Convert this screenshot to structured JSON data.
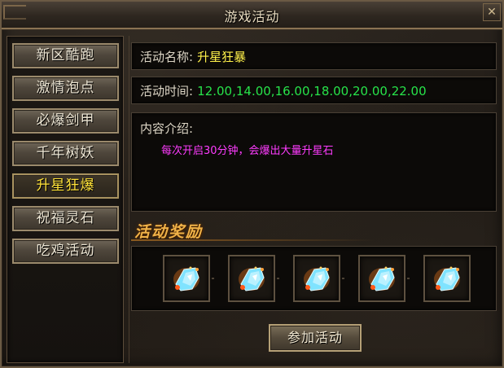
{
  "window": {
    "title": "游戏活动",
    "close_glyph": "✕"
  },
  "menu": {
    "items": [
      {
        "label": "新区酷跑",
        "active": false
      },
      {
        "label": "激情泡点",
        "active": false
      },
      {
        "label": "必爆剑甲",
        "active": false
      },
      {
        "label": "千年树妖",
        "active": false
      },
      {
        "label": "升星狂爆",
        "active": true
      },
      {
        "label": "祝福灵石",
        "active": false
      },
      {
        "label": "吃鸡活动",
        "active": false
      }
    ]
  },
  "activity": {
    "name_label": "活动名称:",
    "name_value": "升星狂暴",
    "time_label": "活动时间:",
    "time_value": "12.00,14.00,16.00,18.00,20.00,22.00",
    "desc_label": "内容介绍:",
    "desc_value": "每次开启30分钟，会爆出大量升星石"
  },
  "rewards": {
    "title": "活动奖励",
    "items": [
      {
        "icon": "crystal-gem-icon"
      },
      {
        "icon": "crystal-gem-icon"
      },
      {
        "icon": "crystal-gem-icon"
      },
      {
        "icon": "crystal-gem-icon"
      },
      {
        "icon": "crystal-gem-icon"
      }
    ]
  },
  "join_button": {
    "label": "参加活动"
  },
  "colors": {
    "active_menu_text": "#ffe23a",
    "name_value": "#fff14a",
    "time_value": "#27e34a",
    "desc_value": "#ff3cff",
    "reward_title": "#f0b248"
  }
}
